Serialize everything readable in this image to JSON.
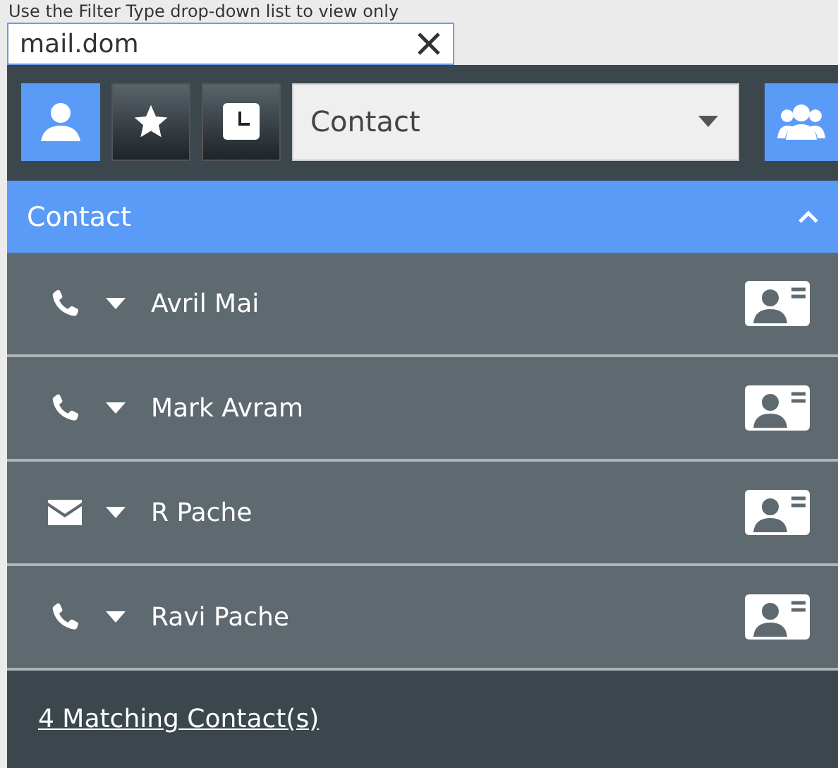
{
  "caption": "Use the Filter Type drop-down list to view only",
  "search": {
    "value": "mail.dom"
  },
  "filters": [
    {
      "kind": "person",
      "selected": true
    },
    {
      "kind": "favorite",
      "selected": false
    },
    {
      "kind": "recent",
      "selected": false
    }
  ],
  "filter_type": {
    "value": "Contact"
  },
  "section": {
    "title": "Contact",
    "expanded": true
  },
  "contacts": [
    {
      "name": "Avril Mai",
      "kind": "phone"
    },
    {
      "name": "Mark Avram",
      "kind": "phone"
    },
    {
      "name": "R Pache",
      "kind": "email"
    },
    {
      "name": "Ravi Pache",
      "kind": "phone"
    }
  ],
  "footer": {
    "link": "4 Matching Contact(s)"
  }
}
